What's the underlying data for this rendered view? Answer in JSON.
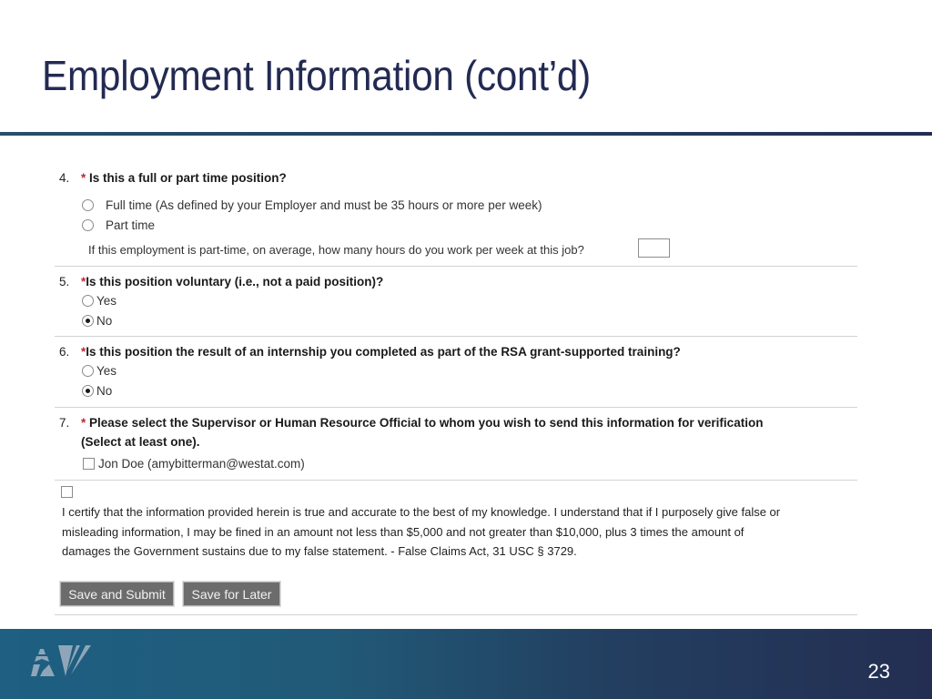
{
  "slide": {
    "title": "Employment Information (cont’d)",
    "page_number": "23",
    "logo_icon": "av-logo-icon"
  },
  "form": {
    "required_marker": "*",
    "questions": [
      {
        "number": "4.",
        "text": "Is this a full or part time position?",
        "options": [
          {
            "label": "Full time (As defined by your Employer and must be 35 hours or more per week)",
            "selected": false
          },
          {
            "label": "Part time",
            "selected": false
          }
        ],
        "followup": {
          "label": "If this employment is part-time, on average, how many hours do you work per week at this job?",
          "value": ""
        }
      },
      {
        "number": "5.",
        "text": "Is this position voluntary (i.e., not a paid position)?",
        "options": [
          {
            "label": "Yes",
            "selected": false
          },
          {
            "label": "No",
            "selected": true
          }
        ]
      },
      {
        "number": "6.",
        "text": "Is this position the result of an internship you completed as part of the RSA grant-supported training?",
        "options": [
          {
            "label": "Yes",
            "selected": false
          },
          {
            "label": "No",
            "selected": true
          }
        ]
      },
      {
        "number": "7.",
        "text": "Please select the Supervisor or Human Resource Official to whom you wish to send this information for verification",
        "subtext": "(Select at least one).",
        "checkboxes": [
          {
            "label": "Jon Doe (amybitterman@westat.com)",
            "checked": false
          }
        ]
      }
    ],
    "certification": {
      "checked": false,
      "lines": [
        "I certify that the information provided herein is true and accurate to the best of my knowledge. I understand that if I purposely give false or",
        "misleading information, I may be fined in an amount not less than $5,000 and not greater than $10,000, plus 3 times the amount of",
        "damages the Government sustains due to my false statement. - False Claims Act, 31 USC § 3729."
      ]
    },
    "buttons": {
      "submit": "Save and Submit",
      "later": "Save for Later"
    }
  },
  "colors": {
    "title": "#232a52",
    "required": "#c0282e",
    "button_bg": "#6c6c6c",
    "footer_start": "#1e5f82",
    "footer_end": "#232e52"
  }
}
